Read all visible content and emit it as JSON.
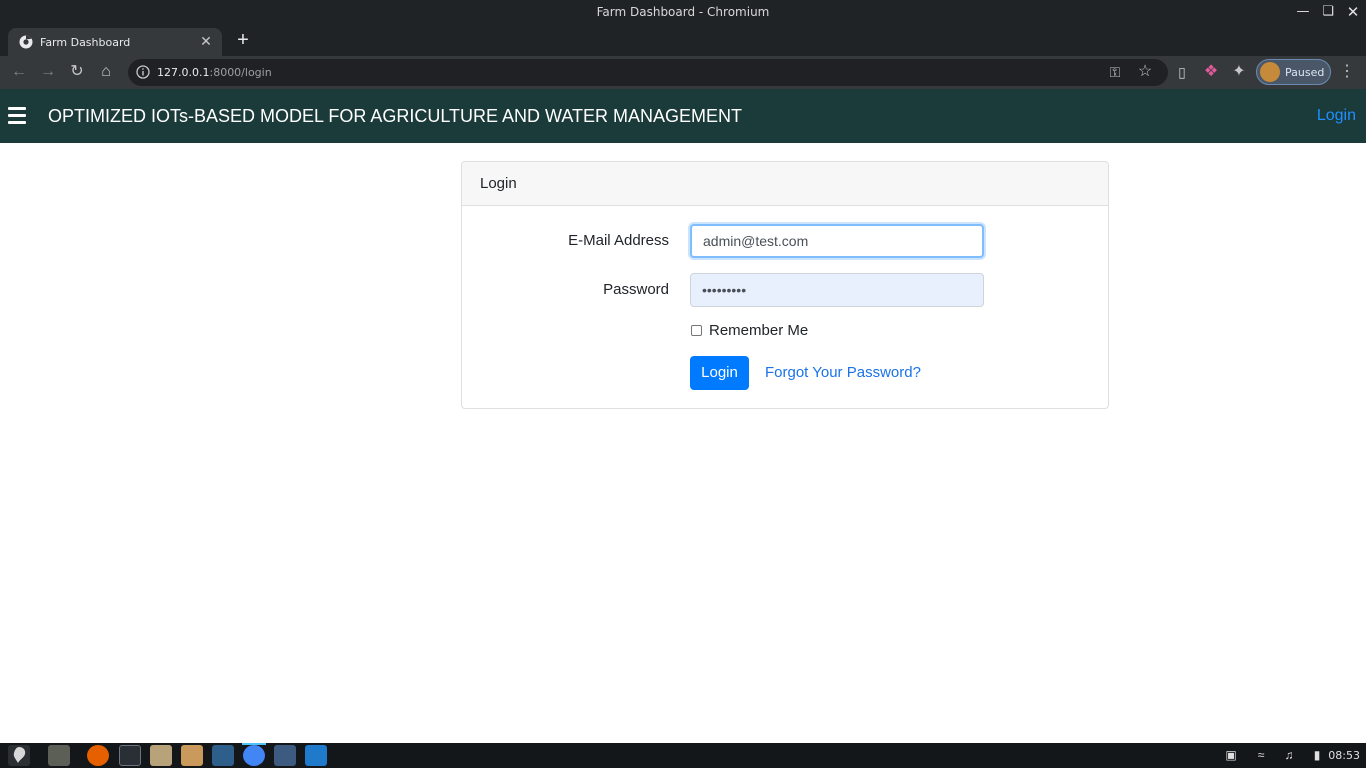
{
  "window": {
    "title": "Farm Dashboard - Chromium",
    "minimize_icon": "minimize-icon",
    "maximize_icon": "maximize-icon",
    "close_icon": "close-icon"
  },
  "browser": {
    "tab": {
      "title": "Farm Dashboard",
      "favicon": "chromium-favicon"
    },
    "address": {
      "host": "127.0.0.1",
      "rest": ":8000/login"
    },
    "profile": {
      "label": "Paused"
    }
  },
  "app": {
    "brand": "OPTIMIZED IOTs-BASED MODEL FOR AGRICULTURE AND WATER MANAGEMENT",
    "nav_login": "Login"
  },
  "login_form": {
    "header": "Login",
    "email_label": "E-Mail Address",
    "email_value": "admin@test.com",
    "password_label": "Password",
    "password_value": "•••••••••",
    "remember_label": "Remember Me",
    "remember_checked": false,
    "submit_label": "Login",
    "forgot_label": "Forgot Your Password?"
  },
  "taskbar": {
    "apps": [
      "gnome-icon",
      "files-icon",
      "firefox-icon",
      "terminal-icon",
      "folder-icon",
      "archive-icon",
      "mysql-workbench-icon",
      "chromium-icon",
      "remote-desktop-icon",
      "vscode-icon"
    ],
    "clock": "08:53"
  },
  "colors": {
    "navbar_bg": "#1b3a3a",
    "primary": "#007bff",
    "link": "#1a73e8"
  }
}
